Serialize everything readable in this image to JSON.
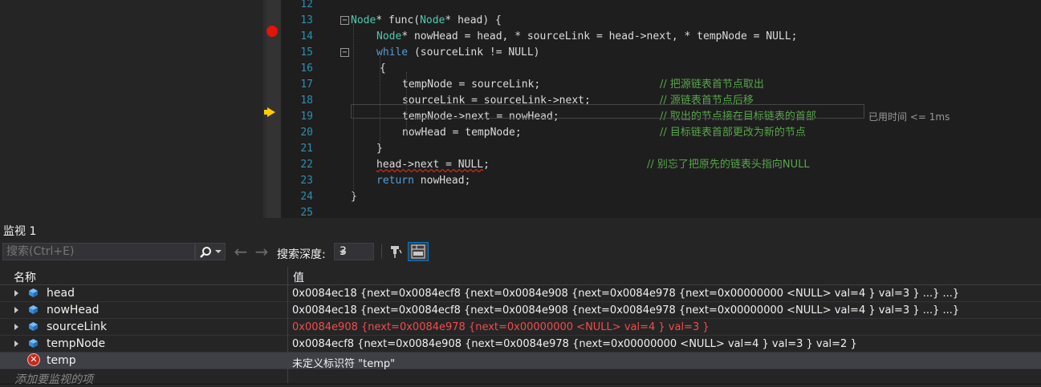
{
  "editor": {
    "lines": [
      {
        "n": "12",
        "tokens": []
      },
      {
        "n": "13",
        "fold": "−",
        "tokens": [
          [
            "ty",
            "Node"
          ],
          [
            "tx",
            "* func("
          ],
          [
            "ty",
            "Node"
          ],
          [
            "tx",
            "* head) {"
          ]
        ]
      },
      {
        "n": "14",
        "tokens": [
          [
            "ty",
            "Node"
          ],
          [
            "tx",
            "* nowHead = head, * sourceLink = head->next, * tempNode = NULL;"
          ]
        ]
      },
      {
        "n": "15",
        "fold": "−",
        "tokens": [
          [
            "kw",
            "while"
          ],
          [
            "tx",
            " (sourceLink != NULL)"
          ]
        ]
      },
      {
        "n": "16",
        "tokens": [
          [
            "tx",
            "{"
          ]
        ]
      },
      {
        "n": "17",
        "tokens": [
          [
            "tx",
            "tempNode = sourceLink;"
          ]
        ],
        "comment": "// 把源链表首节点取出"
      },
      {
        "n": "18",
        "tokens": [
          [
            "tx",
            "sourceLink = sourceLink->next;"
          ]
        ],
        "comment": "// 源链表首节点后移"
      },
      {
        "n": "19",
        "tokens": [
          [
            "tx",
            "tempNode->next = nowHead;"
          ]
        ],
        "comment": "// 取出的节点接在目标链表的首部",
        "elapsed": "已用时间 <= 1ms"
      },
      {
        "n": "20",
        "tokens": [
          [
            "tx",
            "nowHead = tempNode;"
          ]
        ],
        "comment": "// 目标链表首部更改为新的节点"
      },
      {
        "n": "21",
        "tokens": [
          [
            "tx",
            "}"
          ]
        ]
      },
      {
        "n": "22",
        "tokens": [
          [
            "sq",
            "head->next = NULL"
          ],
          [
            "tx",
            ";"
          ]
        ],
        "comment": "// 别忘了把原先的链表头指向NULL"
      },
      {
        "n": "23",
        "tokens": [
          [
            "kw",
            "return"
          ],
          [
            "tx",
            " nowHead;"
          ]
        ]
      },
      {
        "n": "24",
        "tokens": [
          [
            "tx",
            "}"
          ]
        ]
      },
      {
        "n": "25",
        "tokens": []
      }
    ]
  },
  "watch": {
    "title": "监视 1",
    "search_placeholder": "搜索(Ctrl+E)",
    "depth_label": "搜索深度:",
    "depth_value": "3",
    "col_name": "名称",
    "col_value": "值",
    "rows": [
      {
        "name": "head",
        "value": "0x0084ec18 {next=0x0084ecf8 {next=0x0084e908 {next=0x0084e978 {next=0x00000000 <NULL> val=4 } val=3 } ...} ...}",
        "changed": false,
        "error": false
      },
      {
        "name": "nowHead",
        "value": "0x0084ec18 {next=0x0084ecf8 {next=0x0084e908 {next=0x0084e978 {next=0x00000000 <NULL> val=4 } val=3 } ...} ...}",
        "changed": false,
        "error": false
      },
      {
        "name": "sourceLink",
        "value": "0x0084e908 {next=0x0084e978 {next=0x00000000 <NULL> val=4 } val=3 }",
        "changed": true,
        "error": false
      },
      {
        "name": "tempNode",
        "value": "0x0084ecf8 {next=0x0084e908 {next=0x0084e978 {next=0x00000000 <NULL> val=4 } val=3 } val=2 }",
        "changed": false,
        "error": false
      },
      {
        "name": "temp",
        "value": "未定义标识符 \"temp\"",
        "changed": false,
        "error": true
      }
    ],
    "add_row": "添加要监视的项"
  },
  "colors": {
    "keyword": "#569cd6",
    "type": "#4ec9b0",
    "comment": "#57a64a",
    "changed": "#f14c4c",
    "accent": "#007acc"
  }
}
